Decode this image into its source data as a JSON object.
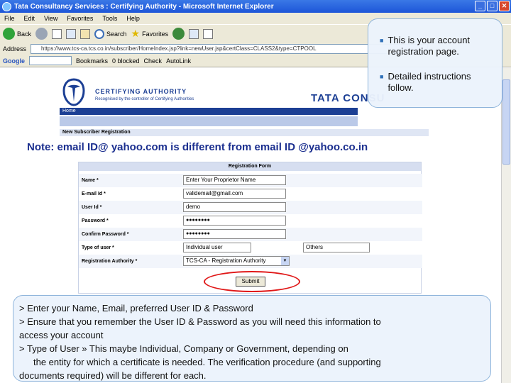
{
  "window": {
    "title": "Tata Consultancy Services : Certifying Authority - Microsoft Internet Explorer",
    "minimize": "_",
    "maximize": "□",
    "close": "✕"
  },
  "menu": [
    "File",
    "Edit",
    "View",
    "Favorites",
    "Tools",
    "Help"
  ],
  "toolbar": {
    "back_label": "Back",
    "search_label": "Search",
    "favorites_label": "Favorites"
  },
  "address": {
    "label": "Address",
    "url": "https://www.tcs-ca.tcs.co.in/subscriber/HomeIndex.jsp?link=newUser.jsp&certClass=CLASS2&type=CTPOOL"
  },
  "google": {
    "label": "Google",
    "bookmarks_label": "Bookmarks",
    "blocked_label": "0 blocked",
    "check_label": "Check",
    "autolink_label": "AutoLink"
  },
  "site": {
    "ca_title": "CERTIFYING AUTHORITY",
    "ca_subtitle": "Recognised by the controller of Certifying Authorities",
    "tcs_brand": "TATA CONSU",
    "nav_home": "Home",
    "section_title": "New Subscriber Registration"
  },
  "note": "Note: email ID@ yahoo.com is different from email ID @yahoo.co.in",
  "form": {
    "heading": "Registration Form",
    "name_label": "Name *",
    "name_value": "Enter Your Proprietor Name",
    "email_label": "E-mail Id *",
    "email_value": "validemail@gmail.com",
    "userid_label": "User Id *",
    "userid_value": "demo",
    "password_label": "Password *",
    "password_value": "●●●●●●●●",
    "confirm_label": "Confirm Password *",
    "confirm_value": "●●●●●●●●",
    "usertype_label": "Type of user *",
    "usertype_value": "Individual user",
    "others_value": "Others",
    "authority_label": "Registration Authority *",
    "authority_value": "TCS-CA - Registration Authority",
    "submit_label": "Submit"
  },
  "callout_top": [
    "This is your account registration page.",
    "Detailed instructions follow."
  ],
  "callout_bottom": {
    "line1": ">  Enter your Name, Email, preferred User ID & Password",
    "line2": ">  Ensure that you remember the User ID & Password as you will need this information to",
    "line3": "access your account",
    "line4": "> Type of User » This maybe Individual, Company or Government, depending on",
    "line5": "the entity for which a certificate is needed. The verification procedure (and supporting",
    "line6": "documents required) will be different for each."
  },
  "colors": {
    "accent_blue": "#1c3f94",
    "note_blue": "#1b2f8f",
    "highlight_red": "#e01818",
    "callout_bg": "#ebf3fc"
  }
}
